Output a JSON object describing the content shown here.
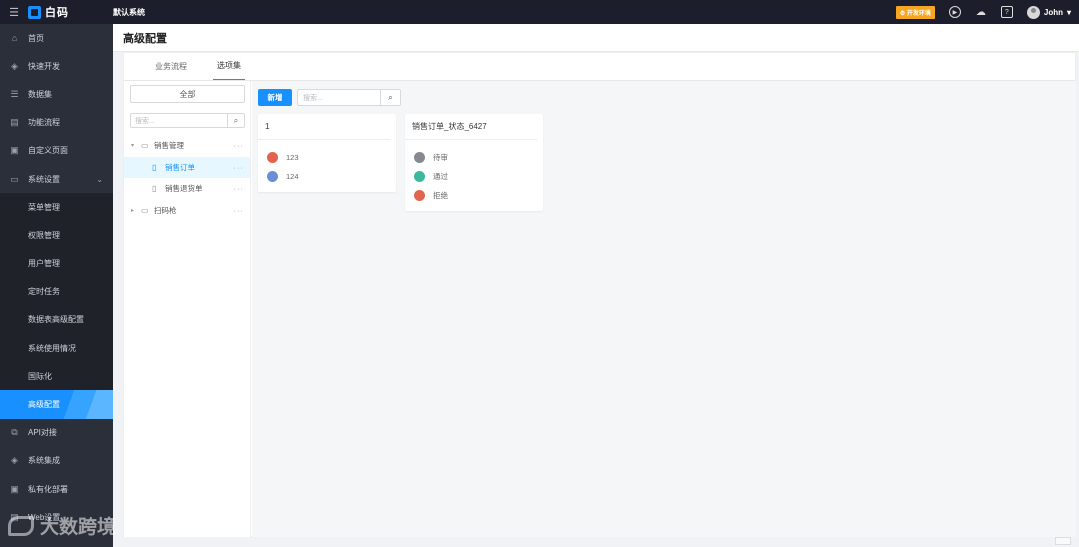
{
  "topbar": {
    "logo_text": "白码",
    "app_name": "默认系统",
    "env_badge": "⚙ 开发环境",
    "user_name": "John"
  },
  "sidebar": {
    "items": [
      {
        "label": "首页",
        "icon": "home-icon"
      },
      {
        "label": "快速开发",
        "icon": "cube-icon"
      },
      {
        "label": "数据集",
        "icon": "database-icon"
      },
      {
        "label": "功能流程",
        "icon": "flow-icon"
      },
      {
        "label": "自定义页面",
        "icon": "page-icon"
      },
      {
        "label": "系统设置",
        "icon": "settings-icon"
      }
    ],
    "sub_items": [
      "菜单管理",
      "权限管理",
      "用户管理",
      "定时任务",
      "数据表高级配置",
      "系统使用情况",
      "国际化",
      "高级配置"
    ],
    "bottom_items": [
      {
        "label": "API对接",
        "icon": "api-icon"
      },
      {
        "label": "系统集成",
        "icon": "integration-icon"
      },
      {
        "label": "私有化部署",
        "icon": "deploy-icon"
      },
      {
        "label": "Web设置",
        "icon": "web-icon"
      }
    ]
  },
  "page": {
    "title": "高级配置",
    "tabs": [
      "业务流程",
      "选项集"
    ]
  },
  "left_panel": {
    "all_label": "全部",
    "search_placeholder": "搜索...",
    "tree": [
      {
        "label": "销售管理",
        "type": "folder",
        "expanded": true
      },
      {
        "label": "销售订单",
        "type": "file",
        "selected": true
      },
      {
        "label": "销售退货单",
        "type": "file"
      },
      {
        "label": "扫码枪",
        "type": "folder",
        "expanded": false
      }
    ]
  },
  "right_panel": {
    "add_label": "新增",
    "search_placeholder": "搜索...",
    "cards": [
      {
        "title": "1",
        "options": [
          {
            "label": "123",
            "color": "#e0654f"
          },
          {
            "label": "124",
            "color": "#6b8fd6"
          }
        ]
      },
      {
        "title": "销售订单_状态_6427",
        "options": [
          {
            "label": "待审",
            "color": "#86898f"
          },
          {
            "label": "通过",
            "color": "#3db89a"
          },
          {
            "label": "拒绝",
            "color": "#e0654f"
          }
        ]
      }
    ]
  },
  "watermark": "大数跨境"
}
